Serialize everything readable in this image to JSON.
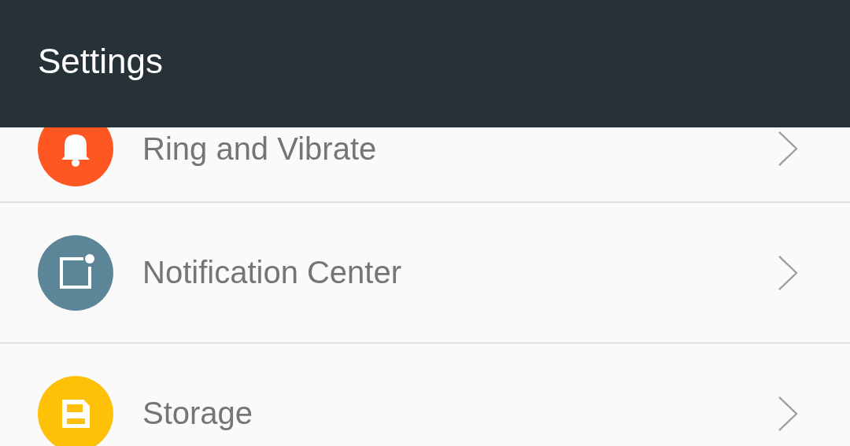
{
  "app_bar": {
    "title": "Settings"
  },
  "items": [
    {
      "label": "Ring and Vibrate",
      "kind": "bell",
      "color": "#ff5722"
    },
    {
      "label": "Notification Center",
      "kind": "notification",
      "color": "#5d8598"
    },
    {
      "label": "Storage",
      "kind": "storage",
      "color": "#ffc107"
    }
  ]
}
